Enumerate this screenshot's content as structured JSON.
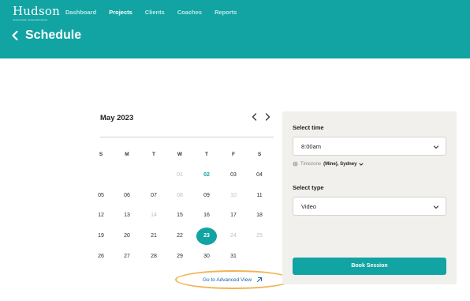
{
  "app": {
    "logo": "Hudson",
    "logo_tagline": "Great people. Great performance."
  },
  "nav": {
    "items": [
      {
        "label": "Dashboard",
        "active": false
      },
      {
        "label": "Projects",
        "active": true
      },
      {
        "label": "Clients",
        "active": false
      },
      {
        "label": "Coaches",
        "active": false
      },
      {
        "label": "Reports",
        "active": false
      }
    ]
  },
  "page": {
    "title": "Schedule",
    "back_icon": "chevron-left-icon"
  },
  "calendar": {
    "month_label": "May 2023",
    "prev_icon": "chevron-left-icon",
    "next_icon": "chevron-right-icon",
    "weekdays": [
      "S",
      "M",
      "T",
      "W",
      "T",
      "F",
      "S"
    ],
    "weeks": [
      [
        "",
        "",
        "",
        "01",
        "02",
        "03",
        "04"
      ],
      [
        "05",
        "06",
        "07",
        "08",
        "09",
        "10",
        "11"
      ],
      [
        "12",
        "13",
        "14",
        "15",
        "16",
        "17",
        "18"
      ],
      [
        "19",
        "20",
        "21",
        "22",
        "23",
        "24",
        "25"
      ],
      [
        "26",
        "27",
        "28",
        "29",
        "30",
        "31",
        ""
      ]
    ],
    "muted_days": [
      "01",
      "08",
      "10",
      "14",
      "24",
      "25"
    ],
    "today": "02",
    "selected": "23"
  },
  "advanced_link": {
    "label": "Go to Advanced View",
    "icon": "external-arrow-icon",
    "highlight_color": "#f0b453"
  },
  "booking": {
    "time_label": "Select time",
    "time_value": "8:00am",
    "timezone_label": "Timezone",
    "timezone_value": "(Mine), Sydney",
    "timezone_icon": "globe-icon",
    "type_label": "Select type",
    "type_value": "Video",
    "book_label": "Book Session"
  },
  "colors": {
    "brand": "#12a3a3",
    "panel_bg": "#f2f0ed",
    "muted_text": "#bdbdbd"
  }
}
